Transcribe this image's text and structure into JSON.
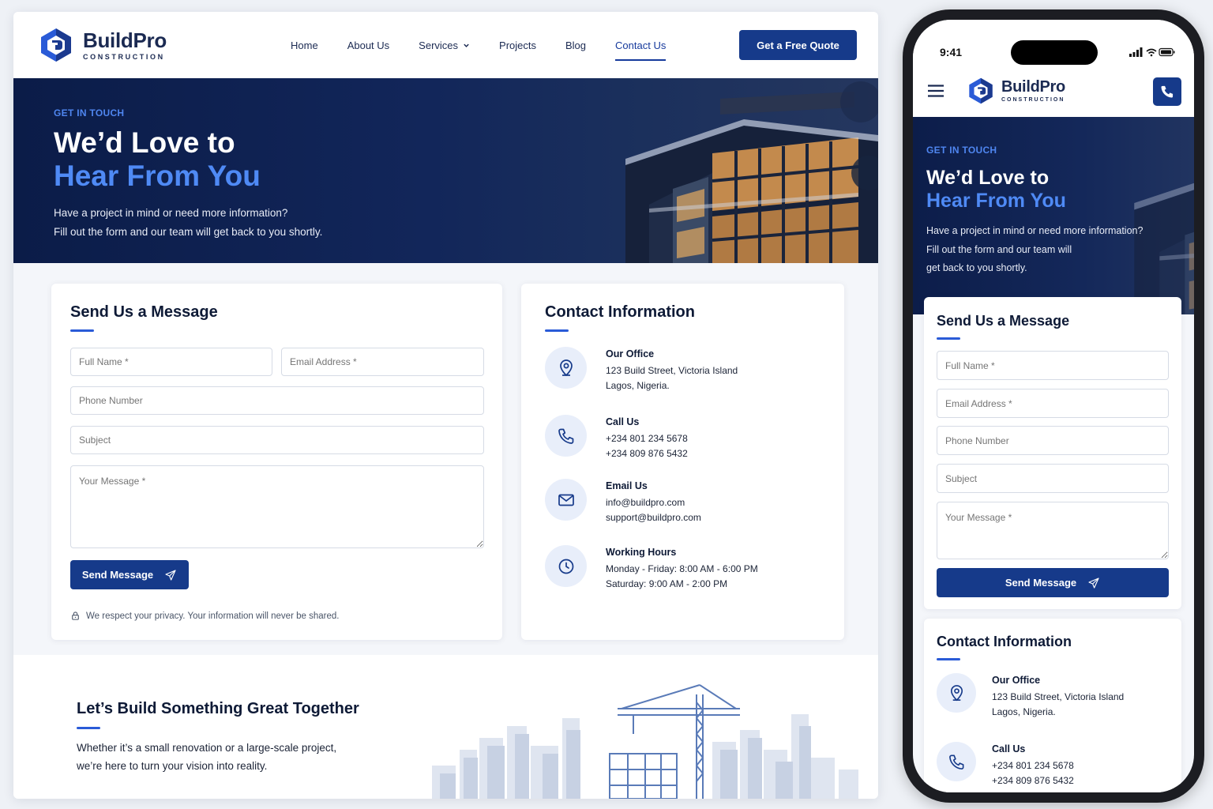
{
  "brand": {
    "name": "BuildPro",
    "tagline": "CONSTRUCTION"
  },
  "nav": {
    "items": [
      {
        "label": "Home"
      },
      {
        "label": "About Us"
      },
      {
        "label": "Services"
      },
      {
        "label": "Projects"
      },
      {
        "label": "Blog"
      },
      {
        "label": "Contact Us"
      }
    ],
    "active": "Contact Us",
    "cta": "Get a Free Quote"
  },
  "hero": {
    "eyebrow": "GET IN TOUCH",
    "title_line1": "We’d Love to",
    "title_line2": "Hear From You",
    "desc_line1": "Have a project in mind or need more information?",
    "desc_line2": "Fill out the form and our team will get back to you shortly.",
    "mobile_desc_line1": "Have a project in mind or need more information?",
    "mobile_desc_line2": "Fill out the form and our team will",
    "mobile_desc_line3": "get back to you shortly."
  },
  "form": {
    "title": "Send Us a Message",
    "full_name": "Full Name *",
    "email": "Email Address *",
    "phone": "Phone Number",
    "subject": "Subject",
    "message": "Your Message *",
    "submit": "Send Message",
    "privacy": "We respect your privacy. Your information will never be shared."
  },
  "contact": {
    "title": "Contact Information",
    "office": {
      "title": "Our Office",
      "line1": "123 Build Street, Victoria Island",
      "line2": "Lagos, Nigeria."
    },
    "call": {
      "title": "Call Us",
      "line1": "+234 801 234 5678",
      "line2": "+234 809 876 5432"
    },
    "email": {
      "title": "Email Us",
      "line1": "info@buildpro.com",
      "line2": "support@buildpro.com"
    },
    "hours": {
      "title": "Working Hours",
      "line1": "Monday - Friday: 8:00 AM - 6:00 PM",
      "line2": "Saturday: 9:00 AM - 2:00 PM"
    }
  },
  "cta_section": {
    "title": "Let’s Build Something Great Together",
    "line1": "Whether it’s a small renovation or a large-scale project,",
    "line2": "we’re here to turn your vision into reality."
  },
  "mobile": {
    "time": "9:41"
  },
  "colors": {
    "primary": "#163a8a",
    "accent": "#4f8af5",
    "hero_bg": "#0b1c48"
  }
}
